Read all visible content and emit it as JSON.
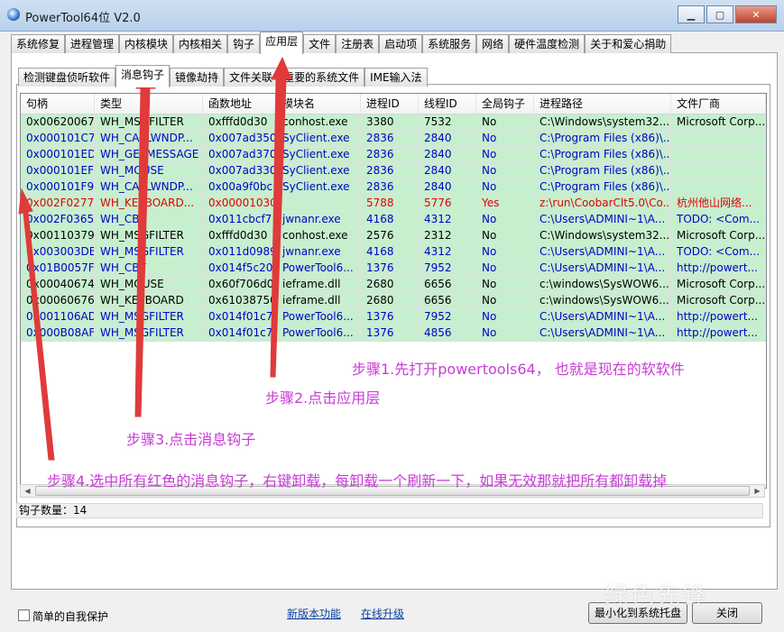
{
  "window": {
    "title": "PowerTool64位 V2.0",
    "min": "▁",
    "max": "▢",
    "close": "✕",
    "icon": "powertool-app-icon"
  },
  "tabs": [
    "系统修复",
    "进程管理",
    "内核模块",
    "内核相关",
    "钩子",
    "应用层",
    "文件",
    "注册表",
    "启动项",
    "系统服务",
    "网络",
    "硬件温度检测",
    "关于和爱心捐助"
  ],
  "subtabs": [
    "检测键盘侦听软件",
    "消息钩子",
    "镜像劫持",
    "文件关联",
    "重要的系统文件",
    "IME输入法"
  ],
  "columns": [
    "句柄",
    "类型",
    "函数地址",
    "模块名",
    "进程ID",
    "线程ID",
    "全局钩子",
    "进程路径",
    "文件厂商"
  ],
  "rows": [
    {
      "color": "#000000",
      "cells": [
        "0x00620067",
        "WH_MSGFILTER",
        "0xfffd0d30",
        "conhost.exe",
        "3380",
        "7532",
        "No",
        "C:\\Windows\\system32...",
        "Microsoft Corp..."
      ]
    },
    {
      "color": "#0000c8",
      "cells": [
        "0x000101C7",
        "WH_CALLWNDP...",
        "0x007ad350",
        "SyClient.exe",
        "2836",
        "2840",
        "No",
        "C:\\Program Files (x86)\\...",
        ""
      ]
    },
    {
      "color": "#0000c8",
      "cells": [
        "0x000101ED",
        "WH_GETMESSAGE",
        "0x007ad370",
        "SyClient.exe",
        "2836",
        "2840",
        "No",
        "C:\\Program Files (x86)\\...",
        ""
      ]
    },
    {
      "color": "#0000c8",
      "cells": [
        "0x000101EF",
        "WH_MOUSE",
        "0x007ad330",
        "SyClient.exe",
        "2836",
        "2840",
        "No",
        "C:\\Program Files (x86)\\...",
        ""
      ]
    },
    {
      "color": "#0000c8",
      "cells": [
        "0x000101F9",
        "WH_CALLWNDP...",
        "0x00a9f0bc",
        "SyClient.exe",
        "2836",
        "2840",
        "No",
        "C:\\Program Files (x86)\\...",
        ""
      ]
    },
    {
      "color": "#e00000",
      "cells": [
        "0x002F0277",
        "WH_KEYBOARD...",
        "0x00001030",
        "",
        "5788",
        "5776",
        "Yes",
        "z:\\run\\CoobarClt5.0\\Co...",
        "杭州他山网络..."
      ]
    },
    {
      "color": "#0000c8",
      "cells": [
        "0x002F0365",
        "WH_CBT",
        "0x011cbcf7",
        "jwnanr.exe",
        "4168",
        "4312",
        "No",
        "C:\\Users\\ADMINI~1\\A...",
        "TODO: <Com..."
      ]
    },
    {
      "color": "#000000",
      "cells": [
        "0x00110379",
        "WH_MSGFILTER",
        "0xfffd0d30",
        "conhost.exe",
        "2576",
        "2312",
        "No",
        "C:\\Windows\\system32...",
        "Microsoft Corp..."
      ]
    },
    {
      "color": "#0000c8",
      "cells": [
        "0x003003DB",
        "WH_MSGFILTER",
        "0x011d0989",
        "jwnanr.exe",
        "4168",
        "4312",
        "No",
        "C:\\Users\\ADMINI~1\\A...",
        "TODO: <Com..."
      ]
    },
    {
      "color": "#0000c8",
      "cells": [
        "0x01B0057F",
        "WH_CBT",
        "0x014f5c20",
        "PowerTool6...",
        "1376",
        "7952",
        "No",
        "C:\\Users\\ADMINI~1\\A...",
        "http://powert..."
      ]
    },
    {
      "color": "#000000",
      "cells": [
        "0x00040674",
        "WH_MOUSE",
        "0x60f706d0",
        "ieframe.dll",
        "2680",
        "6656",
        "No",
        "c:\\windows\\SysWOW6...",
        "Microsoft Corp..."
      ]
    },
    {
      "color": "#000000",
      "cells": [
        "0x00060676",
        "WH_KEYBOARD",
        "0x61038750",
        "ieframe.dll",
        "2680",
        "6656",
        "No",
        "c:\\windows\\SysWOW6...",
        "Microsoft Corp..."
      ]
    },
    {
      "color": "#0000c8",
      "cells": [
        "0x001106AD",
        "WH_MSGFILTER",
        "0x014f01c7",
        "PowerTool6...",
        "1376",
        "7952",
        "No",
        "C:\\Users\\ADMINI~1\\A...",
        "http://powert..."
      ]
    },
    {
      "color": "#0000c8",
      "cells": [
        "0x000B08AF",
        "WH_MSGFILTER",
        "0x014f01c7",
        "PowerTool6...",
        "1376",
        "4856",
        "No",
        "C:\\Users\\ADMINI~1\\A...",
        "http://powert..."
      ]
    }
  ],
  "status": "钩子数量：14",
  "footer": {
    "self_protect": "简单的自我保护",
    "link_new": "新版本功能",
    "link_update": "在线升级",
    "minimize_tray": "最小化到系统托盘",
    "close": "关闭"
  },
  "annotations": {
    "step1": "步骤1.先打开powertools64， 也就是现在的软软件",
    "step2": "步骤2.点击应用层",
    "step3": "步骤3.点击消息钩子",
    "step4": "步骤4.选中所有红色的消息钩子，右键卸载，每卸载一个刷新一下，如果无效那就把所有都卸载掉"
  },
  "watermark": "绿色先锋",
  "colors": {
    "row_bg": "#c6efce",
    "annotation": "#c83bd6",
    "arrow": "#e03a3a"
  }
}
